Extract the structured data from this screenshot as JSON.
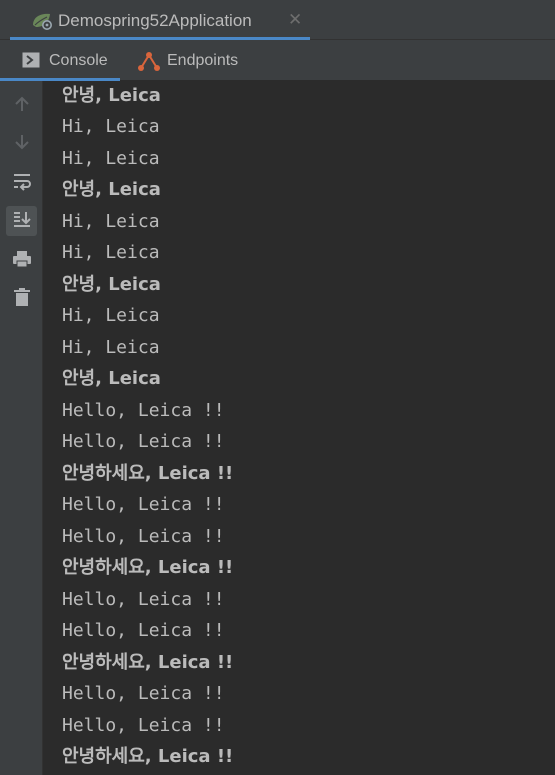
{
  "run_tab": {
    "label": "Demospring52Application",
    "close_glyph": "✕",
    "icon": "spring-boot-icon",
    "accent": "#4a88c7"
  },
  "tool_tabs": [
    {
      "label": "Console",
      "icon": "console-icon",
      "selected": true
    },
    {
      "label": "Endpoints",
      "icon": "endpoints-icon",
      "selected": false
    }
  ],
  "side_toolbar": [
    {
      "icon": "up-arrow-icon",
      "active": false
    },
    {
      "icon": "down-arrow-icon",
      "active": false
    },
    {
      "icon": "soft-wrap-icon",
      "active": false
    },
    {
      "icon": "scroll-to-end-icon",
      "active": true
    },
    {
      "icon": "print-icon",
      "active": false
    },
    {
      "icon": "trash-icon",
      "active": false
    }
  ],
  "console": {
    "text_color": "#bbbbbb",
    "lines": [
      "안녕, Leica",
      "Hi, Leica",
      "Hi, Leica",
      "안녕, Leica",
      "Hi, Leica",
      "Hi, Leica",
      "안녕, Leica",
      "Hi, Leica",
      "Hi, Leica",
      "안녕, Leica",
      "Hello, Leica !!",
      "Hello, Leica !!",
      "안녕하세요, Leica !!",
      "Hello, Leica !!",
      "Hello, Leica !!",
      "안녕하세요, Leica !!",
      "Hello, Leica !!",
      "Hello, Leica !!",
      "안녕하세요, Leica !!",
      "Hello, Leica !!",
      "Hello, Leica !!",
      "안녕하세요, Leica !!"
    ]
  }
}
